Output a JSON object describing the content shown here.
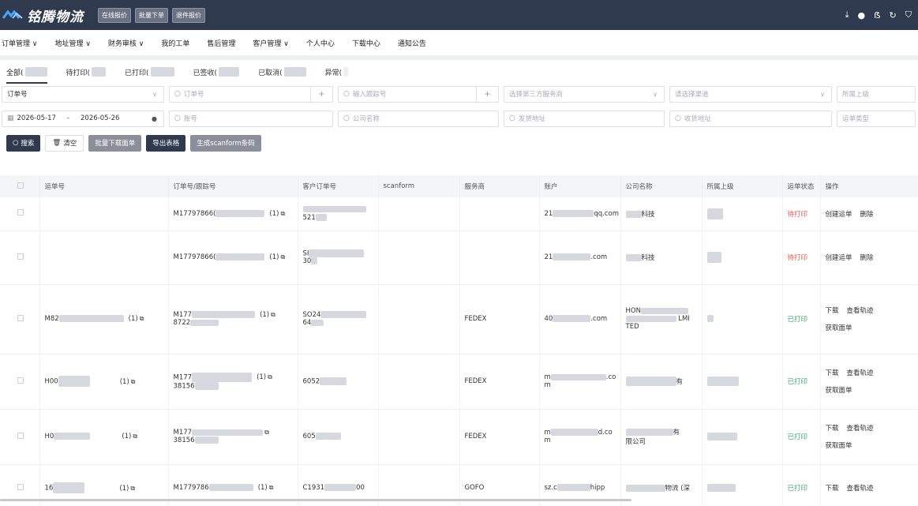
{
  "app": {
    "logo_text": "铭腾物流",
    "top_buttons": [
      "在线报价",
      "批量下单",
      "退件报价"
    ],
    "top_icons": [
      "download-icon",
      "bell-icon",
      "translate-icon",
      "refresh-icon",
      "shirt-icon"
    ]
  },
  "nav": [
    {
      "label": "订单管理 ∨"
    },
    {
      "label": "地址管理 ∨"
    },
    {
      "label": "财务审核 ∨"
    },
    {
      "label": "我的工单"
    },
    {
      "label": "售后管理"
    },
    {
      "label": "客户管理 ∨"
    },
    {
      "label": "个人中心"
    },
    {
      "label": "下载中心"
    },
    {
      "label": "通知公告"
    }
  ],
  "status_tabs": [
    "全部(",
    "待打印(",
    "已打印(",
    "已签收(",
    "已取消(",
    "异常("
  ],
  "filters": {
    "row1": {
      "order_type": "订单号",
      "order_no_ph": "订单号",
      "tracking_ph": "输入跟踪号",
      "provider_ph": "选择第三方服务商",
      "channel_ph": "请选择渠道",
      "parent_ph": "所属上级"
    },
    "row2": {
      "date_start": "2026-05-17",
      "date_sep": "-",
      "date_end": "2026-05-26",
      "account_ph": "账号",
      "company_ph": "公司名称",
      "sender_ph": "发货地址",
      "receiver_ph": "收货地址",
      "waybill_type_ph": "运单类型"
    }
  },
  "actions": {
    "search": "搜索",
    "clear": "清空",
    "batch_download": "批量下载面单",
    "export": "导出表格",
    "scanform": "生成scanform条码"
  },
  "table": {
    "headers": [
      "运单号",
      "订单号/跟踪号",
      "客户订单号",
      "scanform",
      "服务商",
      "账户",
      "公司名称",
      "所属上级",
      "运单状态",
      "操作"
    ],
    "rows": [
      {
        "waybill": "",
        "waybill_cnt": "",
        "order": "M17797866(",
        "order_cnt": "(1)",
        "order2": "",
        "cust": "521",
        "provider": "",
        "account_a": "21",
        "account_b": "qq.com",
        "company": "科技",
        "status": "待打印",
        "status_class": "pending",
        "ops": [
          "创建运单",
          "删除"
        ],
        "ops2": []
      },
      {
        "waybill": "",
        "waybill_cnt": "",
        "order": "M17797866(",
        "order_cnt": "(1)",
        "order2": "",
        "cust": "SI",
        "cust2": "30",
        "provider": "",
        "account_a": "21",
        "account_b": ".com",
        "company": "科技",
        "status": "待打印",
        "status_class": "pending",
        "ops": [
          "创建运单",
          "删除"
        ],
        "ops2": []
      },
      {
        "waybill": "M82",
        "waybill_cnt": "(1)",
        "order": "M177",
        "order_cnt": "(1)",
        "order2": "8722",
        "cust": "SO24",
        "cust2": "64",
        "provider": "FEDEX",
        "account_a": "40",
        "account_b": ".com",
        "company": "HON",
        "company2": "LMI",
        "company3": "TED",
        "status": "已打印",
        "status_class": "printed",
        "ops": [
          "下载",
          "查看轨迹"
        ],
        "ops2": [
          "获取面单"
        ]
      },
      {
        "waybill": "H00",
        "waybill_cnt": "(1)",
        "order": "M177",
        "order_cnt": "(1)",
        "order2": "38156",
        "cust": "6052",
        "provider": "FEDEX",
        "account_a": "m",
        "account_b": ".co",
        "account_c": "m",
        "company": "有",
        "status": "已打印",
        "status_class": "printed",
        "ops": [
          "下载",
          "查看轨迹"
        ],
        "ops2": [
          "获取面单"
        ]
      },
      {
        "waybill": "H0",
        "waybill_cnt": "(1)",
        "order": "M177",
        "order_cnt": "",
        "order2": "38156",
        "cust": "605",
        "provider": "FEDEX",
        "account_a": "m",
        "account_b": "d.co",
        "account_c": "m",
        "company": "有",
        "company2": "限公司",
        "status": "已打印",
        "status_class": "printed",
        "ops": [
          "下载",
          "查看轨迹"
        ],
        "ops2": [
          "获取面单"
        ]
      },
      {
        "waybill": "16",
        "waybill_cnt": "(1)",
        "order": "M1779786",
        "order_cnt": "(1)",
        "order2": "",
        "cust": "C1931",
        "cust2": "00",
        "provider": "GOFO",
        "account_a": "sz.c",
        "account_b": "hipp",
        "company": "物流 (深",
        "status": "已打印",
        "status_class": "printed",
        "ops": [
          "下载",
          "查看轨迹"
        ],
        "ops2": []
      }
    ]
  },
  "colors": {
    "topbar": "#2f3a4e",
    "pending": "#e25a4f",
    "printed": "#3aa86b"
  }
}
